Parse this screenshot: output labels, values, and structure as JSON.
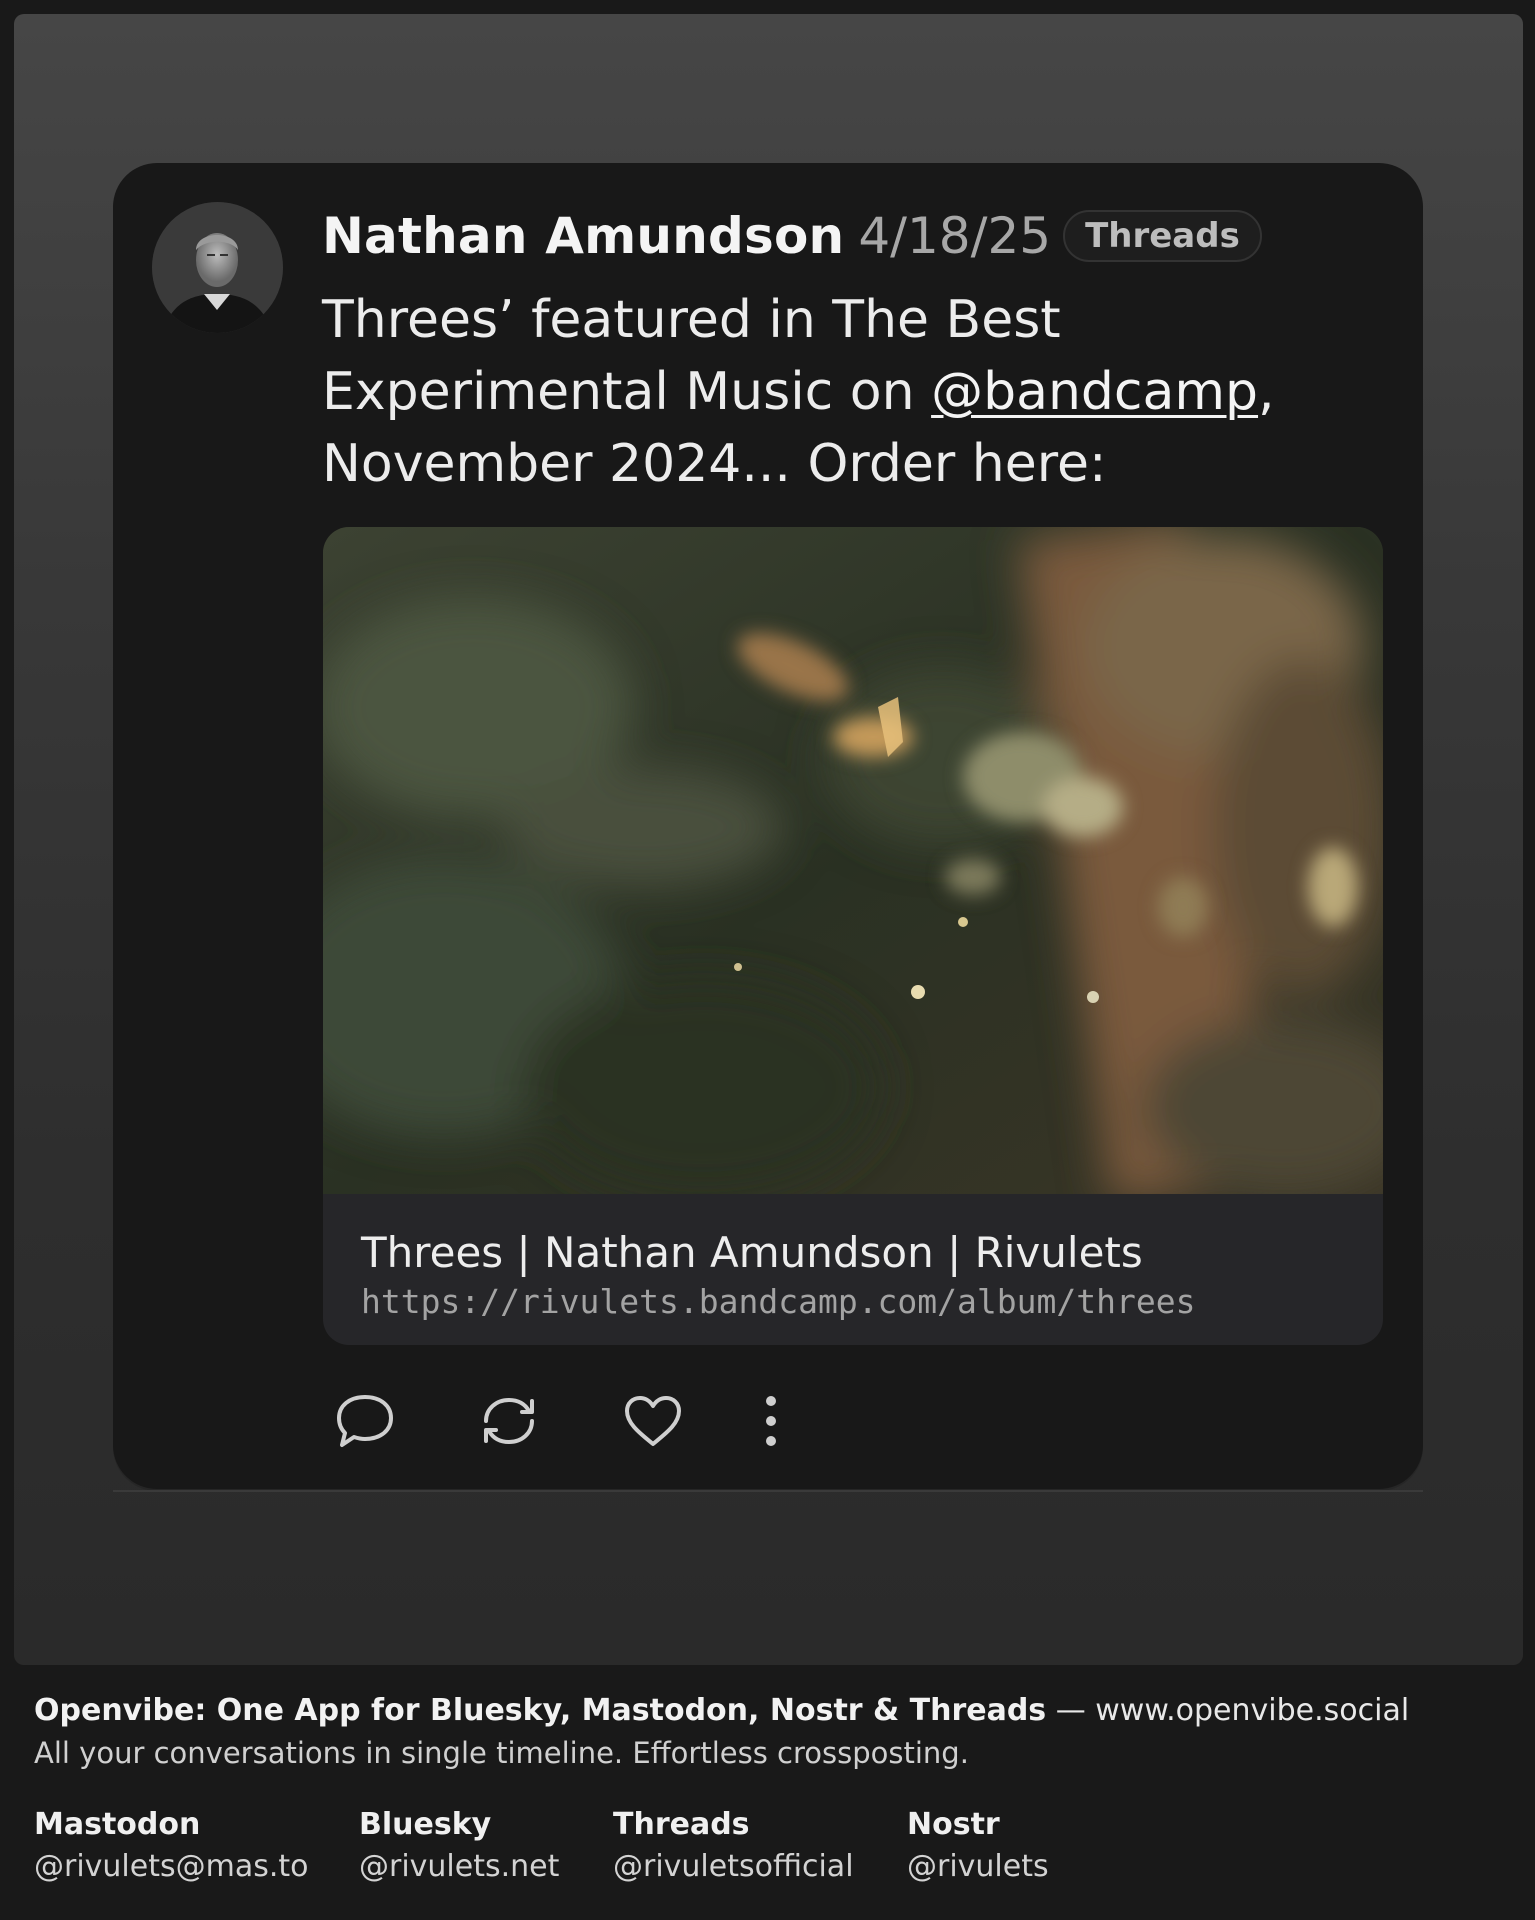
{
  "post": {
    "author": "Nathan Amundson",
    "date": "4/18/25",
    "network_badge": "Threads",
    "text_before": "Threes’ featured in The Best Experimental Music on ",
    "mention": "@bandcamp",
    "text_after": ", November 2024... Order here:",
    "link_preview": {
      "title": "Threes | Nathan Amundson | Rivulets",
      "url": "https://rivulets.bandcamp.com/album/threes"
    },
    "actions": {
      "reply_icon": "speech-bubble-icon",
      "repost_icon": "repost-arrows-icon",
      "like_icon": "heart-icon",
      "more_icon": "vertical-ellipsis-icon"
    }
  },
  "footer": {
    "app_title": "Openvibe: One App for Bluesky, Mastodon, Nostr & Threads",
    "separator": " — ",
    "website": "www.openvibe.social",
    "tagline": "All your conversations in single timeline. Effortless crossposting.",
    "socials": [
      {
        "network": "Mastodon",
        "handle": "@rivulets@mas.to"
      },
      {
        "network": "Bluesky",
        "handle": "@rivulets.net"
      },
      {
        "network": "Threads",
        "handle": "@rivuletsofficial"
      },
      {
        "network": "Nostr",
        "handle": "@rivulets"
      }
    ]
  },
  "colors": {
    "card_background": "#181818",
    "page_background": "#191919",
    "link_bar": "#262629"
  }
}
